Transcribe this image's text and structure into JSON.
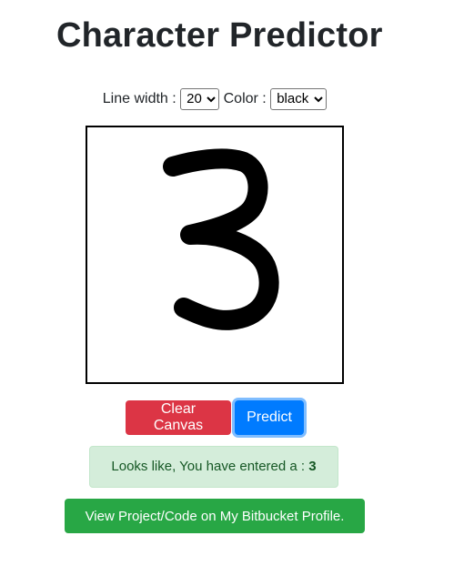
{
  "page": {
    "title": "Character Predictor"
  },
  "controls": {
    "line_width_label": "Line width :",
    "line_width_value": "20",
    "color_label": "Color :",
    "color_value": "black"
  },
  "canvas": {
    "stroke_color": "#000000",
    "drawn_character": "3"
  },
  "buttons": {
    "clear_label": "Clear Canvas",
    "predict_label": "Predict",
    "bitbucket_label": "View Project/Code on My Bitbucket Profile."
  },
  "result": {
    "prefix": "Looks like, You have entered a :",
    "value": "3"
  },
  "colors": {
    "danger": "#dc3545",
    "primary": "#007bff",
    "success": "#28a745",
    "alert_bg": "#d4edda",
    "alert_text": "#155724"
  }
}
